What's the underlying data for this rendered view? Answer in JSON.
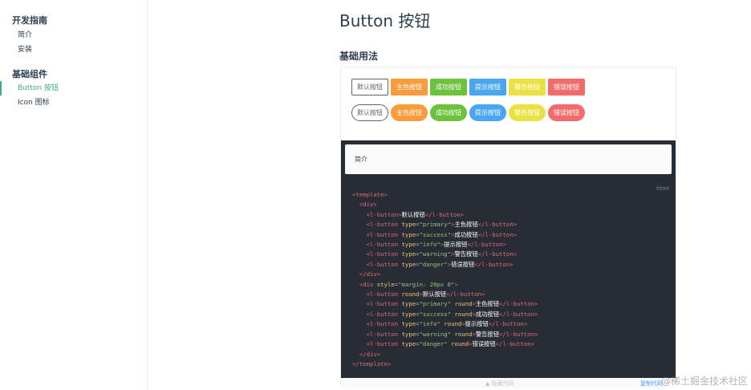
{
  "sidebar": {
    "groups": [
      {
        "title": "开发指南",
        "items": [
          "简介",
          "安装"
        ]
      },
      {
        "title": "基础组件",
        "items": [
          "Button 按钮",
          "Icon 图标"
        ]
      }
    ]
  },
  "main": {
    "title": "Button 按钮",
    "section_title": "基础用法",
    "buttons_row1": [
      "默认按钮",
      "主色按钮",
      "成功按钮",
      "提示按钮",
      "警告按钮",
      "错误按钮"
    ],
    "buttons_row2": [
      "默认按钮",
      "主色按钮",
      "成功按钮",
      "提示按钮",
      "警告按钮",
      "错误按钮"
    ],
    "intro": "简介",
    "code_lang": "html",
    "hide_code": "▲ 隐藏代码",
    "copy_code": "复制代码"
  },
  "watermark": "@稀土掘金技术社区",
  "colors": {
    "accent": "#3eaf7c",
    "primary": "#fa9b3c",
    "success": "#6cc23b",
    "info": "#4aa6f2",
    "warning": "#eae144",
    "danger": "#f26c6c",
    "code_bg": "#282c34"
  }
}
